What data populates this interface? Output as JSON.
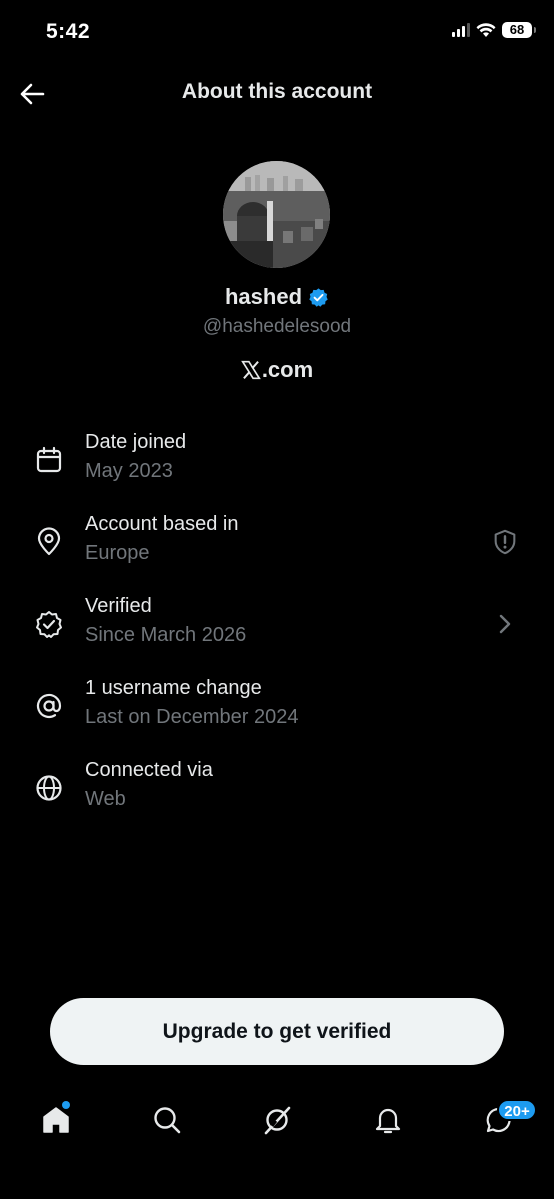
{
  "status_bar": {
    "time": "5:42",
    "battery": "68"
  },
  "header": {
    "title": "About this account"
  },
  "profile": {
    "name": "hashed",
    "handle": "@hashedelesood",
    "domain_suffix": ".com",
    "verified_color": "#1d9bf0"
  },
  "info": [
    {
      "title": "Date joined",
      "sub": "May 2023",
      "icon": "calendar-icon"
    },
    {
      "title": "Account based in",
      "sub": "Europe",
      "icon": "location-pin-icon",
      "right_icon": "shield-alert-icon"
    },
    {
      "title": "Verified",
      "sub": "Since March 2026",
      "icon": "verified-badge-icon",
      "right_icon": "chevron-right-icon"
    },
    {
      "title": "1 username change",
      "sub": "Last on December 2024",
      "icon": "at-sign-icon"
    },
    {
      "title": "Connected via",
      "sub": "Web",
      "icon": "globe-icon"
    }
  ],
  "upgrade": {
    "label": "Upgrade to get verified"
  },
  "tabbar": {
    "items": [
      "home-icon",
      "search-icon",
      "grok-icon",
      "notifications-icon",
      "messages-icon"
    ],
    "messages_badge": "20+",
    "accent": "#1d9bf0"
  }
}
